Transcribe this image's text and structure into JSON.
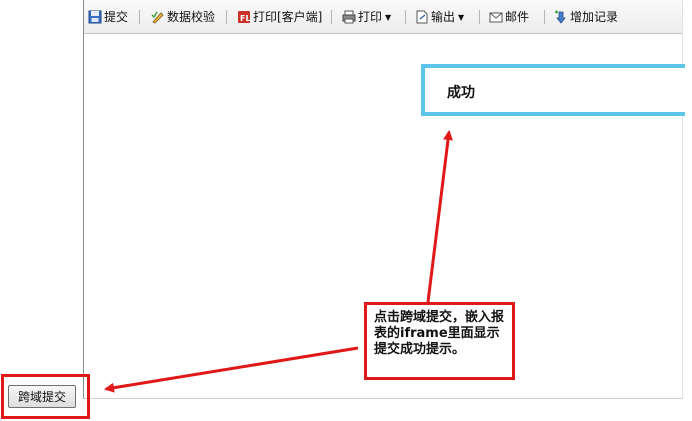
{
  "toolbar": {
    "submit": "提交",
    "validate": "数据校验",
    "print_client": "打印[客户端]",
    "print": "打印",
    "export": "输出",
    "mail": "邮件",
    "add_record": "增加记录"
  },
  "frame": {
    "success_message": "成功"
  },
  "annotation": {
    "text": "点击跨域提交，嵌入报表的iframe里面显示提交成功提示。"
  },
  "cross_domain_button": {
    "label": "跨域提交"
  },
  "colors": {
    "annotation_red": "#e01818",
    "success_border": "#5ec5ea"
  },
  "icons": [
    "save-icon",
    "pencil-check-icon",
    "print-client-icon",
    "printer-icon",
    "export-icon",
    "mail-icon",
    "add-record-icon"
  ]
}
